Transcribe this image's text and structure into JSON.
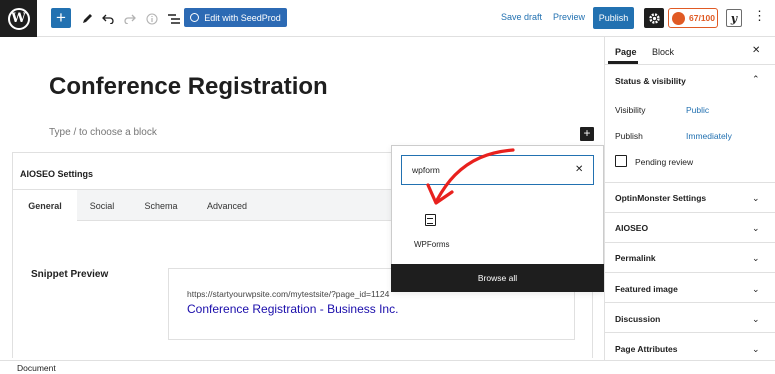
{
  "toolbar": {
    "wp_logo_glyph": "W",
    "add_block_glyph": "+",
    "seedprod_label": "Edit with SeedProd",
    "save_draft_label": "Save draft",
    "preview_label": "Preview",
    "publish_label": "Publish",
    "aioseo_score": "67/100",
    "yoast_glyph": "y",
    "icons": [
      "wordpress-icon",
      "plus-icon",
      "pencil-icon",
      "undo-icon",
      "redo-icon",
      "info-icon",
      "list-view-icon",
      "seedprod-icon",
      "gear-icon",
      "aioseo-icon",
      "yoast-icon",
      "more-options-icon"
    ],
    "accent_color": "#2271b1"
  },
  "editor": {
    "post_title": "Conference Registration",
    "block_prompt": "Type / to choose a block",
    "block_add_glyph": "+"
  },
  "aioseo": {
    "title": "AIOSEO Settings",
    "tabs": [
      {
        "label": "General",
        "active": true
      },
      {
        "label": "Social",
        "active": false
      },
      {
        "label": "Schema",
        "active": false
      },
      {
        "label": "Advanced",
        "active": false
      }
    ],
    "snippet_label": "Snippet Preview",
    "snippet_url": "https://startyourwpsite.com/mytestsite/?page_id=1124",
    "snippet_title": "Conference Registration - Business Inc."
  },
  "inserter": {
    "search_value": "wpform",
    "clear_glyph": "✕",
    "results": [
      {
        "label": "WPForms",
        "icon": "wpforms-icon"
      }
    ],
    "browse_all_label": "Browse all"
  },
  "sidebar": {
    "tabs": [
      {
        "label": "Page",
        "active": true
      },
      {
        "label": "Block",
        "active": false
      }
    ],
    "close_glyph": "✕",
    "status_visibility": {
      "heading": "Status & visibility",
      "visibility_label": "Visibility",
      "visibility_value": "Public",
      "publish_label": "Publish",
      "publish_value": "Immediately",
      "pending_review_label": "Pending review"
    },
    "sections": [
      "OptinMonster Settings",
      "AIOSEO",
      "Permalink",
      "Featured image",
      "Discussion",
      "Page Attributes"
    ]
  },
  "footer": {
    "breadcrumb": "Document"
  }
}
